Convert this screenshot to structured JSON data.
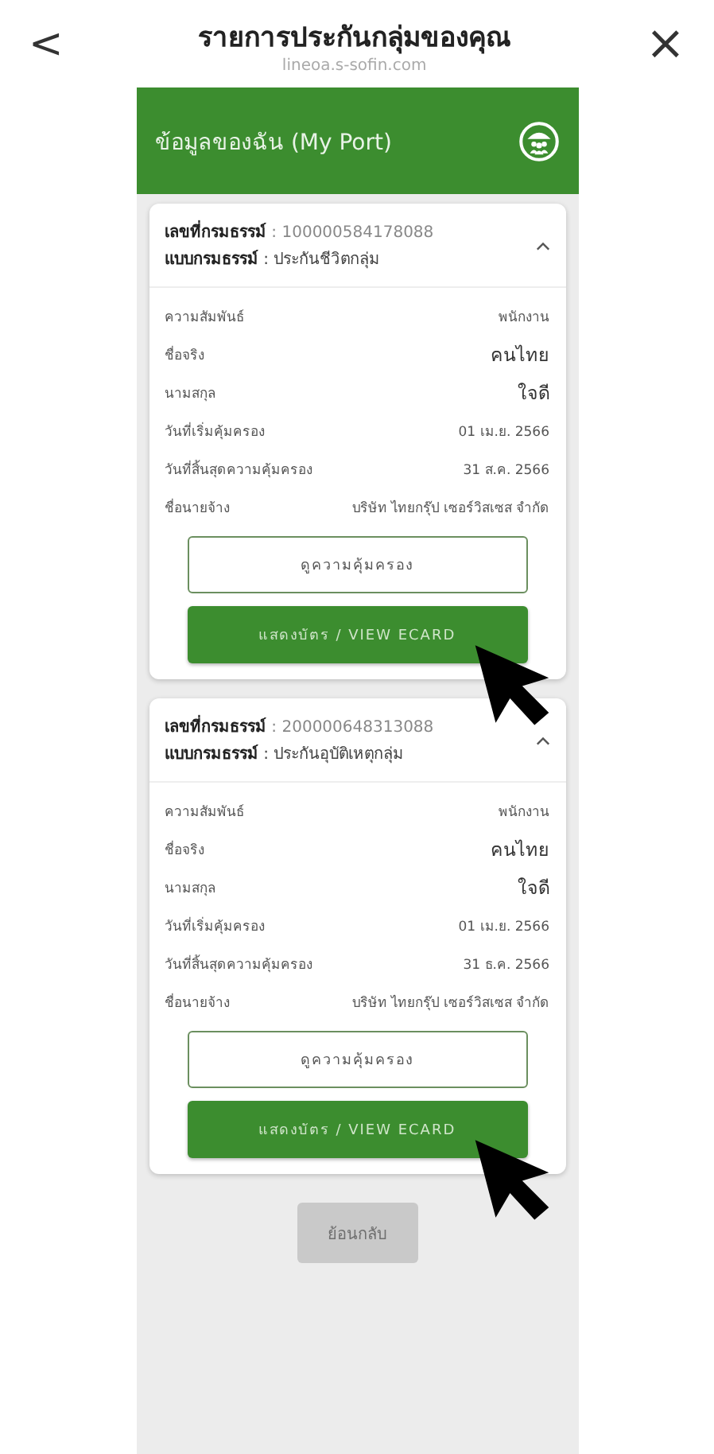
{
  "header": {
    "title": "รายการประกันกลุ่มของคุณ",
    "subtitle": "lineoa.s-sofin.com",
    "back": "<",
    "close": "×"
  },
  "banner": {
    "title": "ข้อมูลของฉัน (My Port)"
  },
  "policies": [
    {
      "number": "**เลขที่กรมธรรม์** : 100000584178088",
      "type": "**แบบกรมธรรม์** : ประกันชีวิตกลุ่ม",
      "expanded": true,
      "rows": [
        {
          "kind": "plain",
          "label": "ความสัมพันธ์",
          "value": "พนักงาน"
        },
        {
          "kind": "name",
          "label": "ชื่อจริง",
          "value": "คนไทย"
        },
        {
          "kind": "name",
          "label": "นามสกุล",
          "value": "ใจดี"
        },
        {
          "kind": "plain",
          "label": "วันที่เริ่มคุ้มครอง",
          "value": "01 เม.ย. 2566"
        },
        {
          "kind": "plain",
          "label": "วันที่สิ้นสุดความคุ้มครอง",
          "value": "31 ส.ค. 2566"
        },
        {
          "kind": "plain",
          "label": "ชื่อนายจ้าง",
          "value": "บริษัท ไทยกรุ๊ป เซอร์วิสเซส จำกัด"
        }
      ],
      "coverage_button": "ดูความคุ้มครอง",
      "ecard_button": "แสดงบัตร / VIEW ECARD"
    },
    {
      "number": "**เลขที่กรมธรรม์** : 200000648313088",
      "type": "**แบบกรมธรรม์** : ประกันอุบัติเหตุกลุ่ม",
      "expanded": true,
      "rows": [
        {
          "kind": "plain",
          "label": "ความสัมพันธ์",
          "value": "พนักงาน"
        },
        {
          "kind": "name",
          "label": "ชื่อจริง",
          "value": "คนไทย"
        },
        {
          "kind": "name",
          "label": "นามสกุล",
          "value": "ใจดี"
        },
        {
          "kind": "plain",
          "label": "วันที่เริ่มคุ้มครอง",
          "value": "01 เม.ย. 2566"
        },
        {
          "kind": "plain",
          "label": "วันที่สิ้นสุดความคุ้มครอง",
          "value": "31 ธ.ค. 2566"
        },
        {
          "kind": "plain",
          "label": "ชื่อนายจ้าง",
          "value": "บริษัท ไทยกรุ๊ป เซอร์วิสเซส จำกัด"
        }
      ],
      "coverage_button": "ดูความคุ้มครอง",
      "ecard_button": "แสดงบัตร / VIEW ECARD"
    }
  ],
  "back_button": {
    "label": "ย้อนกลับ",
    "disabled": true
  }
}
